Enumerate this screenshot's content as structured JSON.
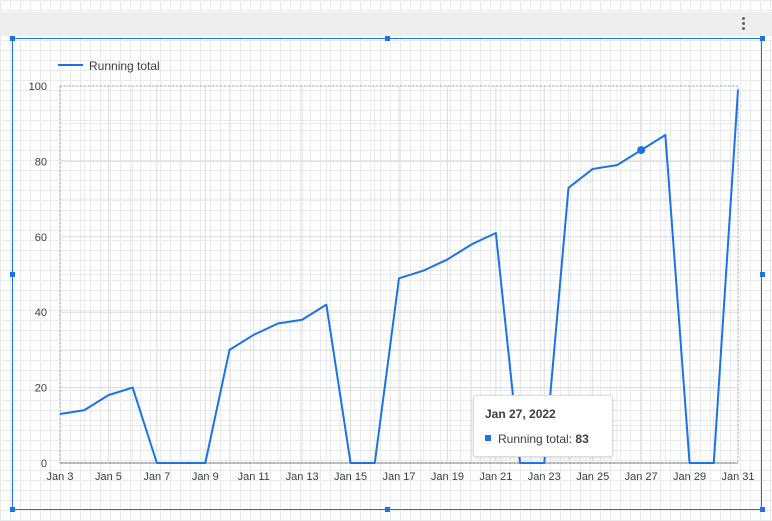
{
  "colors": {
    "series": "#1a73e8",
    "axis": "#9aa0a6",
    "grid": "#dadce0"
  },
  "icons": {
    "menu": "more-vert-icon"
  },
  "chart_data": {
    "type": "line",
    "legend_position": "top-left",
    "grid": true,
    "ylim": [
      0,
      100
    ],
    "yticks": [
      "0",
      "20",
      "40",
      "60",
      "80",
      "100"
    ],
    "xticks": [
      "Jan 3",
      "Jan 5",
      "Jan 7",
      "Jan 9",
      "Jan 11",
      "Jan 13",
      "Jan 15",
      "Jan 17",
      "Jan 19",
      "Jan 21",
      "Jan 23",
      "Jan 25",
      "Jan 27",
      "Jan 29",
      "Jan 31"
    ],
    "x": [
      "Jan 3",
      "Jan 4",
      "Jan 5",
      "Jan 6",
      "Jan 7",
      "Jan 8",
      "Jan 9",
      "Jan 10",
      "Jan 11",
      "Jan 12",
      "Jan 13",
      "Jan 14",
      "Jan 15",
      "Jan 16",
      "Jan 17",
      "Jan 18",
      "Jan 19",
      "Jan 20",
      "Jan 21",
      "Jan 22",
      "Jan 23",
      "Jan 24",
      "Jan 25",
      "Jan 26",
      "Jan 27",
      "Jan 28",
      "Jan 29",
      "Jan 30",
      "Jan 31"
    ],
    "series": [
      {
        "name": "Running total",
        "values": [
          13,
          14,
          18,
          20,
          0,
          0,
          0,
          30,
          34,
          37,
          38,
          42,
          0,
          0,
          49,
          51,
          54,
          58,
          61,
          0,
          0,
          73,
          78,
          79,
          83,
          87,
          0,
          0,
          99
        ]
      }
    ],
    "highlight_index": 24
  },
  "tooltip": {
    "title": "Jan 27, 2022",
    "label": "Running total:",
    "value": "83"
  }
}
